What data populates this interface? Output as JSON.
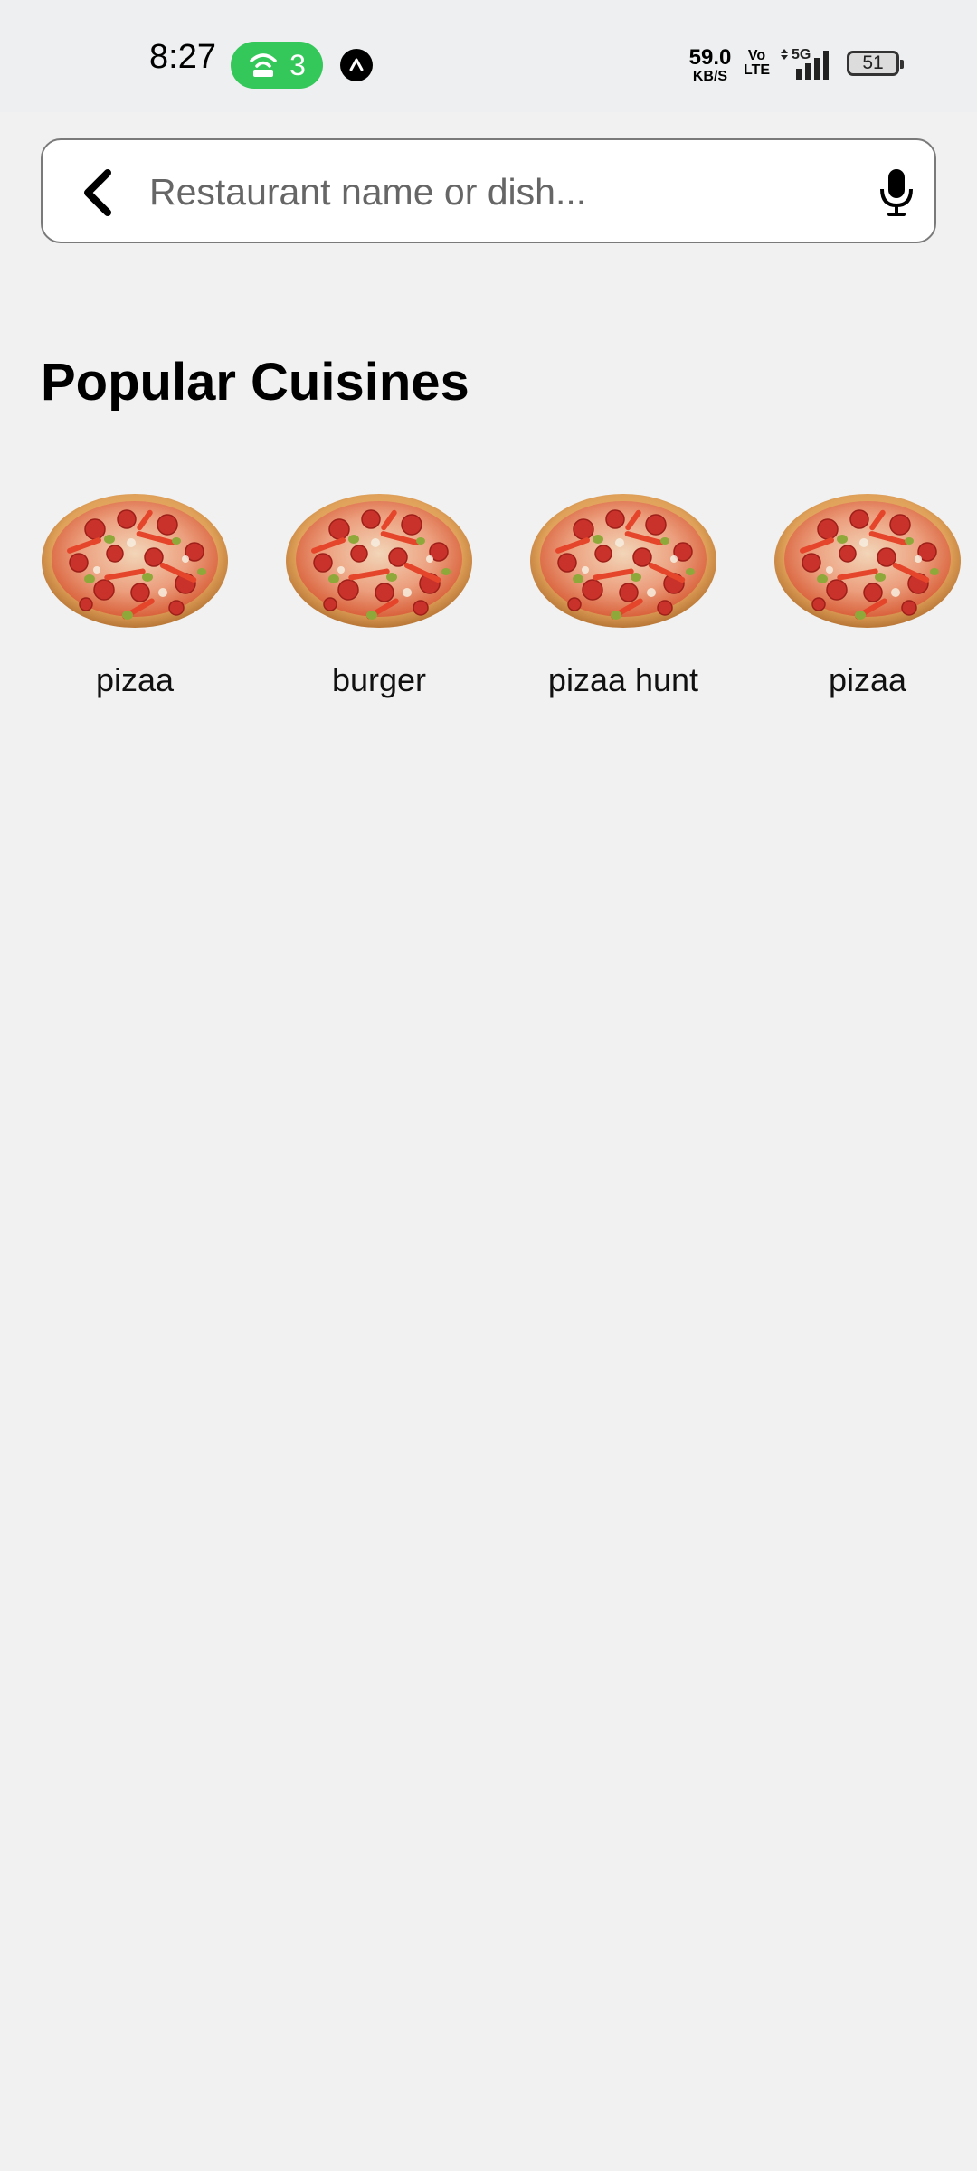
{
  "status_bar": {
    "time": "8:27",
    "hotspot_count": "3",
    "hotspot_color": "#34c759",
    "net_speed_value": "59.0",
    "net_speed_unit": "KB/S",
    "volte_top": "Vo",
    "volte_bottom": "LTE",
    "network_type": "5G",
    "battery_level": "51",
    "icons": [
      "hotspot-icon",
      "navigation-icon",
      "signal-icon",
      "battery-icon"
    ]
  },
  "search": {
    "placeholder": "Restaurant name or dish...",
    "value": "",
    "back_icon": "back-chevron-icon",
    "mic_icon": "microphone-icon"
  },
  "section": {
    "title": "Popular Cuisines"
  },
  "cuisines": [
    {
      "label": "pizaa",
      "image": "pizza"
    },
    {
      "label": "burger",
      "image": "pizza"
    },
    {
      "label": "pizaa hunt",
      "image": "pizza"
    },
    {
      "label": "pizaa",
      "image": "pizza"
    }
  ],
  "colors": {
    "background": "#f1f1f1",
    "status_bar_bg": "#edeff0",
    "search_border": "#7a7a7a"
  }
}
